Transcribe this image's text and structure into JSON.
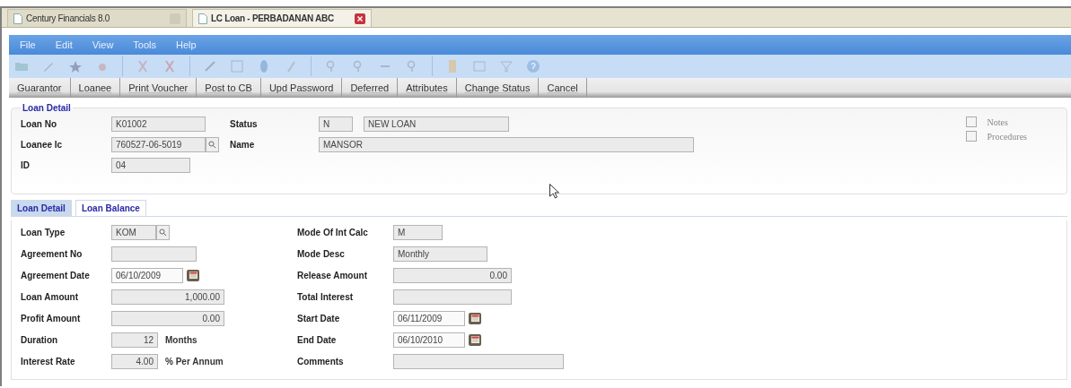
{
  "browser_tabs": [
    {
      "title": "Century Financials 8.0",
      "selected": false
    },
    {
      "title": "LC Loan - PERBADANAN ABC",
      "selected": true
    }
  ],
  "menu": [
    "File",
    "Edit",
    "View",
    "Tools",
    "Help"
  ],
  "actions": [
    "Guarantor",
    "Loanee",
    "Print Voucher",
    "Post to CB",
    "Upd Password",
    "Deferred",
    "Attributes",
    "Change Status",
    "Cancel"
  ],
  "loan_detail": {
    "legend": "Loan Detail",
    "loan_no": {
      "label": "Loan No",
      "value": "K01002"
    },
    "loanee_ic": {
      "label": "Loanee Ic",
      "value": "760527-06-5019"
    },
    "id": {
      "label": "ID",
      "value": "04"
    },
    "status": {
      "label": "Status",
      "code": "N",
      "description": "NEW LOAN"
    },
    "name": {
      "label": "Name",
      "value": "MANSOR"
    },
    "options": [
      {
        "label": "Notes",
        "checked": false
      },
      {
        "label": "Procedures",
        "checked": false
      }
    ]
  },
  "form_tabs": [
    {
      "label": "Loan Detail",
      "selected": true
    },
    {
      "label": "Loan Balance",
      "selected": false
    }
  ],
  "left_fields": [
    {
      "kind": "lookup",
      "label": "Loan Type",
      "value": "KOM"
    },
    {
      "kind": "text",
      "label": "Agreement No"
    },
    {
      "kind": "date",
      "label": "Agreement Date",
      "value": "06/10/2009"
    },
    {
      "kind": "amount",
      "label": "Loan Amount",
      "value": "1,000.00"
    },
    {
      "kind": "amount",
      "label": "Profit Amount",
      "value": "0.00"
    },
    {
      "kind": "amount",
      "label": "Duration",
      "value": "12",
      "suffix": "Months"
    },
    {
      "kind": "amount",
      "label": "Interest Rate",
      "value": "4.00",
      "suffix": "% Per Annum"
    }
  ],
  "right_fields": [
    {
      "kind": "text",
      "label": "Mode Of Int Calc",
      "value": "M"
    },
    {
      "kind": "text",
      "label": "Mode Desc",
      "value": "Monthly"
    },
    {
      "kind": "amount",
      "label": "Release Amount",
      "value": "0.00"
    },
    {
      "kind": "amount",
      "label": "Total Interest"
    },
    {
      "kind": "date",
      "label": "Start Date",
      "value": "06/11/2009"
    },
    {
      "kind": "date",
      "label": "End Date",
      "value": "06/10/2010"
    },
    {
      "kind": "text",
      "label": "Comments"
    }
  ]
}
